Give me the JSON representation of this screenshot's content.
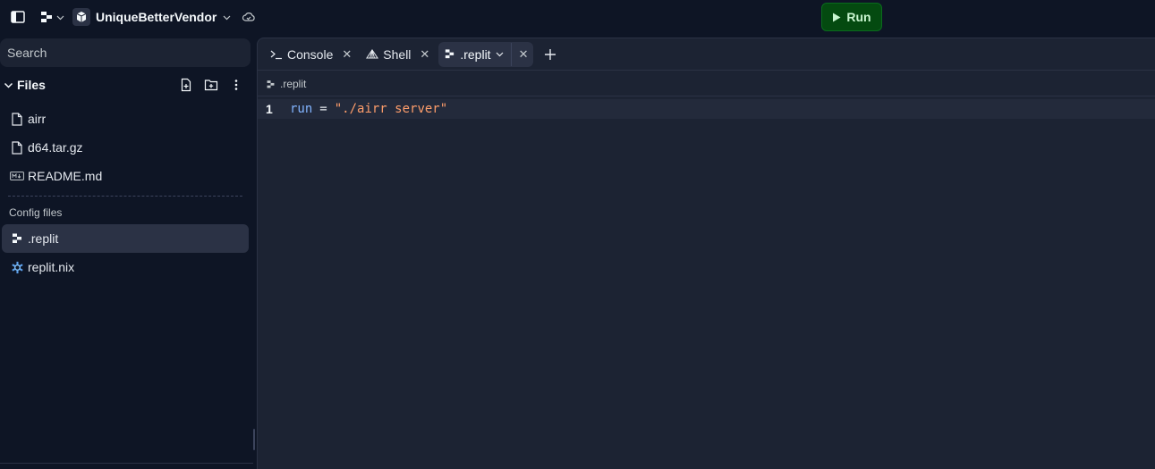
{
  "topbar": {
    "repl_name": "UniqueBetterVendor",
    "run_label": "Run",
    "icons": [
      "sidebar-toggle-icon",
      "replit-logo-icon",
      "chevron-down-icon",
      "repl-avatar-icon",
      "cloud-sync-icon",
      "play-icon"
    ]
  },
  "sidebar": {
    "search_placeholder": "Search",
    "files_title": "Files",
    "files": [
      {
        "name": "airr",
        "icon": "file-icon"
      },
      {
        "name": "d64.tar.gz",
        "icon": "file-icon"
      },
      {
        "name": "README.md",
        "icon": "markdown-icon"
      }
    ],
    "config_label": "Config files",
    "config_files": [
      {
        "name": ".replit",
        "icon": "replit-icon",
        "active": true
      },
      {
        "name": "replit.nix",
        "icon": "nix-icon"
      }
    ]
  },
  "tabs": [
    {
      "label": "Console",
      "icon": "terminal-icon"
    },
    {
      "label": "Shell",
      "icon": "shell-icon"
    },
    {
      "label": ".replit",
      "icon": "replit-icon",
      "active": true
    }
  ],
  "breadcrumb": {
    "label": ".replit"
  },
  "editor": {
    "lines": [
      {
        "number": "1",
        "key": "run",
        "op": "=",
        "value": "\"./airr server\""
      }
    ]
  },
  "colors": {
    "background": "#0e1525",
    "pane": "#1c2333",
    "active": "#2b3245",
    "run": "#044a10",
    "string": "#ff9e6b",
    "keyword": "#82b4ff"
  }
}
